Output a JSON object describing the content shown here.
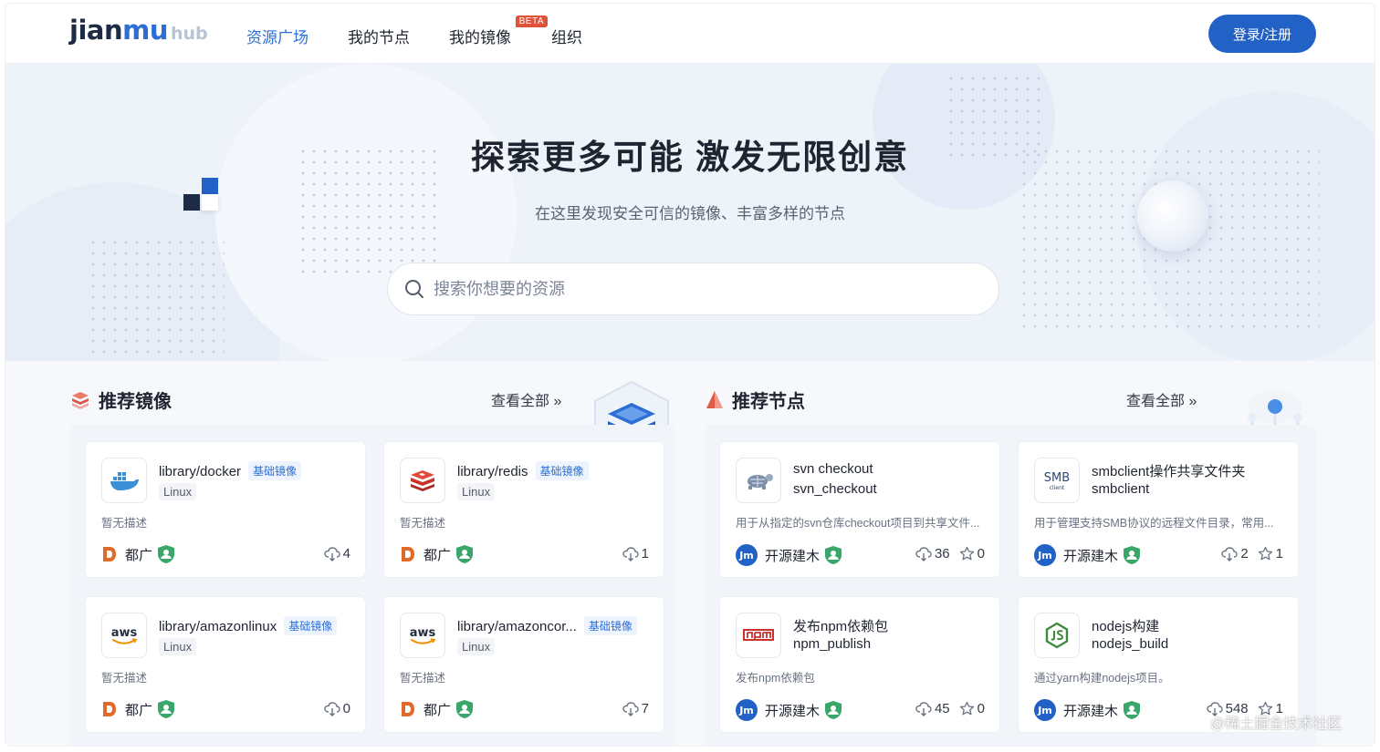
{
  "brand": {
    "logo_main_a": "jian",
    "logo_main_b": "mu",
    "logo_hub": "hub"
  },
  "nav": {
    "items": [
      "资源广场",
      "我的节点",
      "我的镜像",
      "组织"
    ],
    "active_index": 0,
    "beta_badge": "BETA",
    "login_label": "登录/注册"
  },
  "hero": {
    "title": "探索更多可能 激发无限创意",
    "subtitle": "在这里发现安全可信的镜像、丰富多样的节点",
    "search_placeholder": "搜索你想要的资源",
    "search_value": ""
  },
  "images_section": {
    "title": "推荐镜像",
    "view_all": "查看全部 »",
    "cards": [
      {
        "name": "library/docker",
        "tag": "基础镜像",
        "os": "Linux",
        "desc": "暂无描述",
        "owner": "都广",
        "downloads": "4",
        "icon": "docker-icon"
      },
      {
        "name": "library/redis",
        "tag": "基础镜像",
        "os": "Linux",
        "desc": "暂无描述",
        "owner": "都广",
        "downloads": "1",
        "icon": "redis-icon"
      },
      {
        "name": "library/amazonlinux",
        "tag": "基础镜像",
        "os": "Linux",
        "desc": "暂无描述",
        "owner": "都广",
        "downloads": "0",
        "icon": "aws-icon"
      },
      {
        "name": "library/amazoncor...",
        "tag": "基础镜像",
        "os": "Linux",
        "desc": "暂无描述",
        "owner": "都广",
        "downloads": "7",
        "icon": "aws-icon"
      }
    ]
  },
  "nodes_section": {
    "title": "推荐节点",
    "view_all": "查看全部 »",
    "cards": [
      {
        "name": "svn checkout",
        "ref": "svn_checkout",
        "desc": "用于从指定的svn仓库checkout项目到共享文件...",
        "owner": "开源建木",
        "downloads": "36",
        "stars": "0",
        "icon": "svn-icon"
      },
      {
        "name": "smbclient操作共享文件夹",
        "ref": "smbclient",
        "desc": "用于管理支持SMB协议的远程文件目录，常用...",
        "owner": "开源建木",
        "downloads": "2",
        "stars": "1",
        "icon": "smb-icon"
      },
      {
        "name": "发布npm依赖包",
        "ref": "npm_publish",
        "desc": "发布npm依赖包",
        "owner": "开源建木",
        "downloads": "45",
        "stars": "0",
        "icon": "npm-icon"
      },
      {
        "name": "nodejs构建",
        "ref": "nodejs_build",
        "desc": "通过yarn构建nodejs项目。",
        "owner": "开源建木",
        "downloads": "548",
        "stars": "1",
        "icon": "nodejs-icon"
      }
    ]
  },
  "icon_text": {
    "aws": "aws",
    "smb": "SMB",
    "smb_sub": "client",
    "jm": "Jm"
  },
  "watermark": "@稀土掘金技术社区",
  "colors": {
    "primary": "#2262c6",
    "accent_orange": "#e0523a",
    "shield_green": "#3aa66a",
    "text": "#1f2430"
  }
}
